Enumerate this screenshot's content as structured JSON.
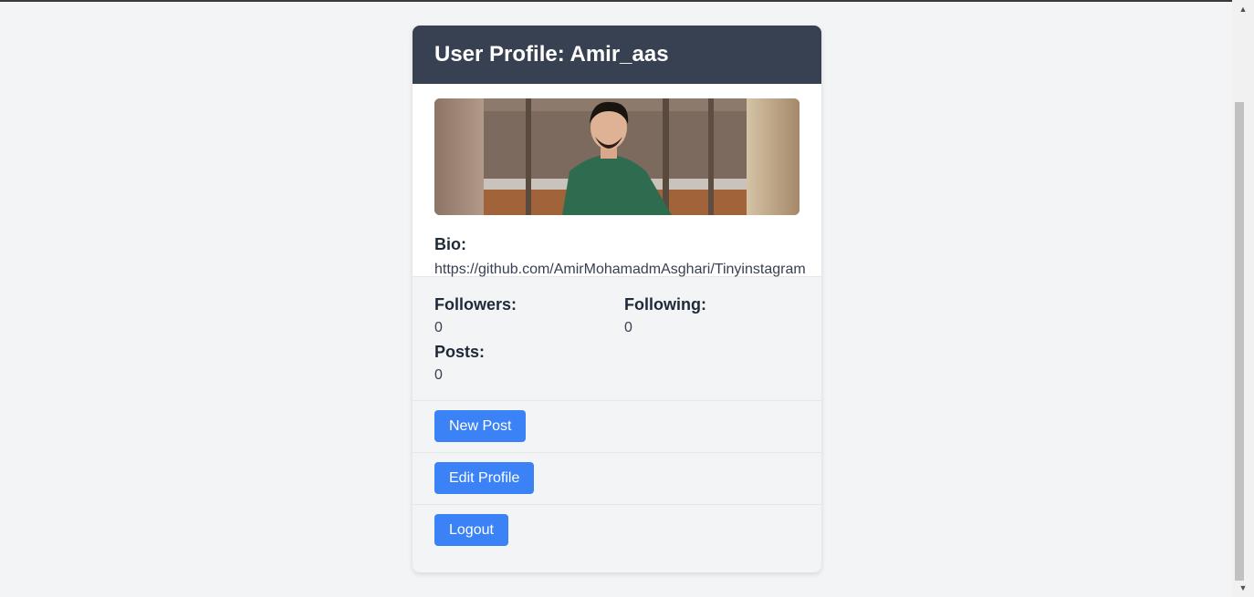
{
  "profile": {
    "title": "User Profile: Amir_aas",
    "bio_label": "Bio:",
    "bio_text": "https://github.com/AmirMohamadmAsghari/Tinyinstagram"
  },
  "stats": {
    "followers_label": "Followers:",
    "followers_value": "0",
    "following_label": "Following:",
    "following_value": "0",
    "posts_label": "Posts:",
    "posts_value": "0"
  },
  "actions": {
    "new_post": "New Post",
    "edit_profile": "Edit Profile",
    "logout": "Logout"
  },
  "colors": {
    "header_bg": "#374151",
    "button_bg": "#3b82f6",
    "page_bg": "#f3f4f6"
  }
}
